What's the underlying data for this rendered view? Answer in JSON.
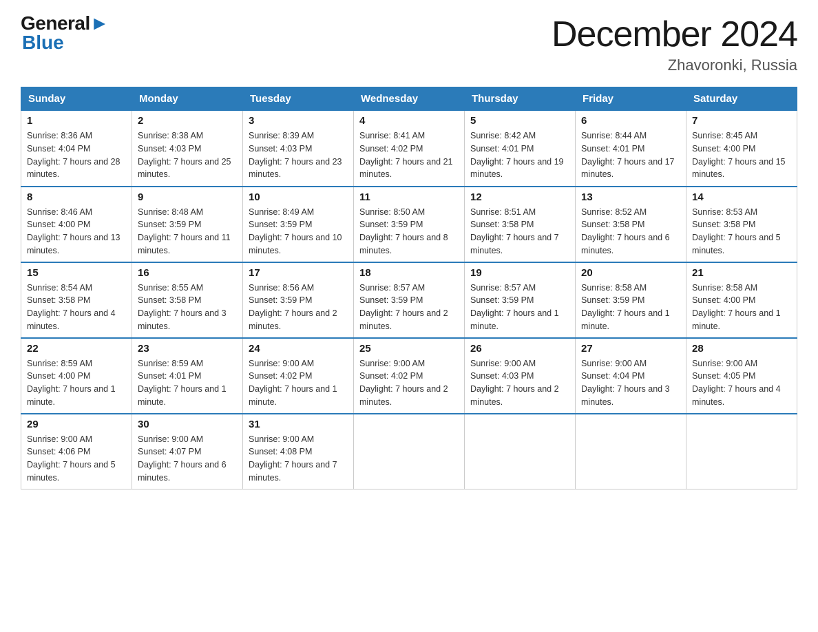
{
  "logo": {
    "part1": "General",
    "part2": "Blue"
  },
  "title": "December 2024",
  "location": "Zhavoronki, Russia",
  "headers": [
    "Sunday",
    "Monday",
    "Tuesday",
    "Wednesday",
    "Thursday",
    "Friday",
    "Saturday"
  ],
  "weeks": [
    [
      {
        "day": "1",
        "sunrise": "8:36 AM",
        "sunset": "4:04 PM",
        "daylight": "7 hours and 28 minutes."
      },
      {
        "day": "2",
        "sunrise": "8:38 AM",
        "sunset": "4:03 PM",
        "daylight": "7 hours and 25 minutes."
      },
      {
        "day": "3",
        "sunrise": "8:39 AM",
        "sunset": "4:03 PM",
        "daylight": "7 hours and 23 minutes."
      },
      {
        "day": "4",
        "sunrise": "8:41 AM",
        "sunset": "4:02 PM",
        "daylight": "7 hours and 21 minutes."
      },
      {
        "day": "5",
        "sunrise": "8:42 AM",
        "sunset": "4:01 PM",
        "daylight": "7 hours and 19 minutes."
      },
      {
        "day": "6",
        "sunrise": "8:44 AM",
        "sunset": "4:01 PM",
        "daylight": "7 hours and 17 minutes."
      },
      {
        "day": "7",
        "sunrise": "8:45 AM",
        "sunset": "4:00 PM",
        "daylight": "7 hours and 15 minutes."
      }
    ],
    [
      {
        "day": "8",
        "sunrise": "8:46 AM",
        "sunset": "4:00 PM",
        "daylight": "7 hours and 13 minutes."
      },
      {
        "day": "9",
        "sunrise": "8:48 AM",
        "sunset": "3:59 PM",
        "daylight": "7 hours and 11 minutes."
      },
      {
        "day": "10",
        "sunrise": "8:49 AM",
        "sunset": "3:59 PM",
        "daylight": "7 hours and 10 minutes."
      },
      {
        "day": "11",
        "sunrise": "8:50 AM",
        "sunset": "3:59 PM",
        "daylight": "7 hours and 8 minutes."
      },
      {
        "day": "12",
        "sunrise": "8:51 AM",
        "sunset": "3:58 PM",
        "daylight": "7 hours and 7 minutes."
      },
      {
        "day": "13",
        "sunrise": "8:52 AM",
        "sunset": "3:58 PM",
        "daylight": "7 hours and 6 minutes."
      },
      {
        "day": "14",
        "sunrise": "8:53 AM",
        "sunset": "3:58 PM",
        "daylight": "7 hours and 5 minutes."
      }
    ],
    [
      {
        "day": "15",
        "sunrise": "8:54 AM",
        "sunset": "3:58 PM",
        "daylight": "7 hours and 4 minutes."
      },
      {
        "day": "16",
        "sunrise": "8:55 AM",
        "sunset": "3:58 PM",
        "daylight": "7 hours and 3 minutes."
      },
      {
        "day": "17",
        "sunrise": "8:56 AM",
        "sunset": "3:59 PM",
        "daylight": "7 hours and 2 minutes."
      },
      {
        "day": "18",
        "sunrise": "8:57 AM",
        "sunset": "3:59 PM",
        "daylight": "7 hours and 2 minutes."
      },
      {
        "day": "19",
        "sunrise": "8:57 AM",
        "sunset": "3:59 PM",
        "daylight": "7 hours and 1 minute."
      },
      {
        "day": "20",
        "sunrise": "8:58 AM",
        "sunset": "3:59 PM",
        "daylight": "7 hours and 1 minute."
      },
      {
        "day": "21",
        "sunrise": "8:58 AM",
        "sunset": "4:00 PM",
        "daylight": "7 hours and 1 minute."
      }
    ],
    [
      {
        "day": "22",
        "sunrise": "8:59 AM",
        "sunset": "4:00 PM",
        "daylight": "7 hours and 1 minute."
      },
      {
        "day": "23",
        "sunrise": "8:59 AM",
        "sunset": "4:01 PM",
        "daylight": "7 hours and 1 minute."
      },
      {
        "day": "24",
        "sunrise": "9:00 AM",
        "sunset": "4:02 PM",
        "daylight": "7 hours and 1 minute."
      },
      {
        "day": "25",
        "sunrise": "9:00 AM",
        "sunset": "4:02 PM",
        "daylight": "7 hours and 2 minutes."
      },
      {
        "day": "26",
        "sunrise": "9:00 AM",
        "sunset": "4:03 PM",
        "daylight": "7 hours and 2 minutes."
      },
      {
        "day": "27",
        "sunrise": "9:00 AM",
        "sunset": "4:04 PM",
        "daylight": "7 hours and 3 minutes."
      },
      {
        "day": "28",
        "sunrise": "9:00 AM",
        "sunset": "4:05 PM",
        "daylight": "7 hours and 4 minutes."
      }
    ],
    [
      {
        "day": "29",
        "sunrise": "9:00 AM",
        "sunset": "4:06 PM",
        "daylight": "7 hours and 5 minutes."
      },
      {
        "day": "30",
        "sunrise": "9:00 AM",
        "sunset": "4:07 PM",
        "daylight": "7 hours and 6 minutes."
      },
      {
        "day": "31",
        "sunrise": "9:00 AM",
        "sunset": "4:08 PM",
        "daylight": "7 hours and 7 minutes."
      },
      null,
      null,
      null,
      null
    ]
  ]
}
